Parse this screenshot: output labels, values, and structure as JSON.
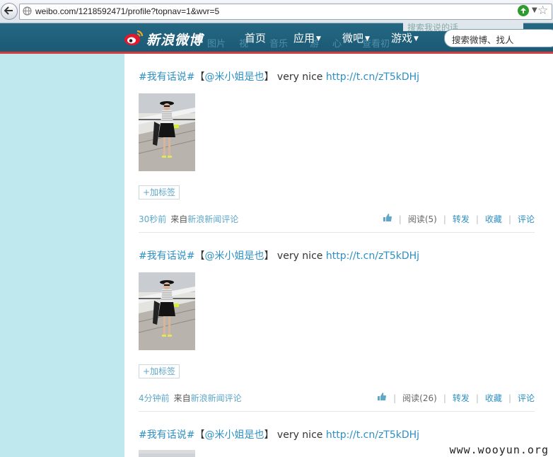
{
  "browser": {
    "url": "weibo.com/1218592471/profile?topnav=1&wvr=5"
  },
  "header": {
    "logo_text": "新浪微博",
    "ghost_nav": [
      "图片",
      "视",
      "音乐",
      "游",
      "心",
      "查看初"
    ],
    "ghost_search": "搜索我说的话",
    "nav": [
      {
        "label": "首页",
        "dropdown": false
      },
      {
        "label": "应用",
        "dropdown": true
      },
      {
        "label": "微吧",
        "dropdown": true
      },
      {
        "label": "游戏",
        "dropdown": true
      }
    ],
    "search_placeholder": "搜索微博、找人"
  },
  "feed": {
    "posts": [
      {
        "topic": "#我有话说#",
        "bracket_open": "【",
        "mention": "@米小姐是也",
        "bracket_close": "】",
        "text": " very nice ",
        "link": "http://t.cn/zT5kDHj",
        "add_tag": "+加标签",
        "time": "30秒前",
        "from": "来自",
        "source": "新浪新闻评论",
        "read": "阅读(5)",
        "forward": "转发",
        "favorite": "收藏",
        "comment": "评论"
      },
      {
        "topic": "#我有话说#",
        "bracket_open": "【",
        "mention": "@米小姐是也",
        "bracket_close": "】",
        "text": " very nice ",
        "link": "http://t.cn/zT5kDHj",
        "add_tag": "+加标签",
        "time": "4分钟前",
        "from": "来自",
        "source": "新浪新闻评论",
        "read": "阅读(26)",
        "forward": "转发",
        "favorite": "收藏",
        "comment": "评论"
      },
      {
        "topic": "#我有话说#",
        "bracket_open": "【",
        "mention": "@米小姐是也",
        "bracket_close": "】",
        "text": " very nice ",
        "link": "http://t.cn/zT5kDHj"
      }
    ]
  },
  "watermark": "www.wooyun.org",
  "colors": {
    "topbar": "#1f6079",
    "accent_red": "#d43c3c",
    "sidebar": "#bfe7ee",
    "link": "#2e8fc2"
  }
}
